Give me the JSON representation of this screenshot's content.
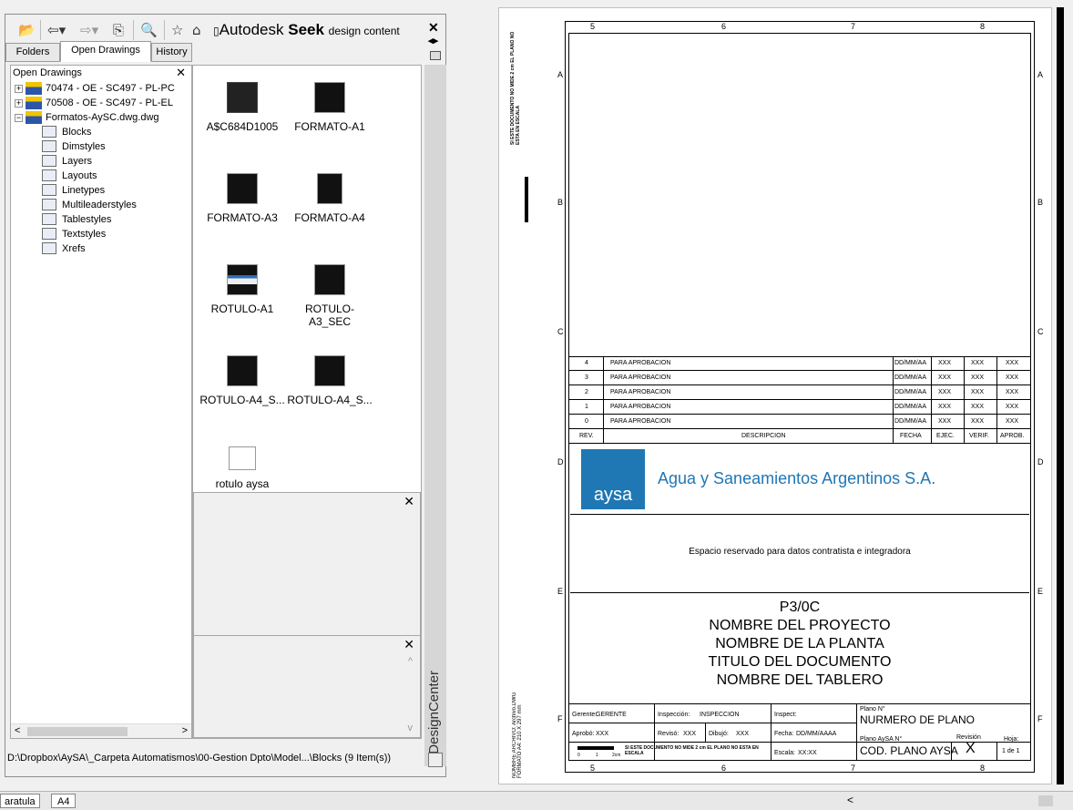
{
  "toolbar": {
    "seek_brand": "Autodesk",
    "seek_word": "Seek",
    "seek_tail": "design content"
  },
  "tabs": [
    {
      "label": "Folders"
    },
    {
      "label": "Open Drawings"
    },
    {
      "label": "History"
    }
  ],
  "tree": {
    "header": "Open Drawings",
    "items": [
      {
        "label": "70474 - OE - SC497 - PL-PC",
        "expander": "+"
      },
      {
        "label": "70508 - OE - SC497 - PL-EL",
        "expander": "+"
      },
      {
        "label": "Formatos-AySC.dwg.dwg",
        "expander": "−"
      },
      {
        "label": "Blocks"
      },
      {
        "label": "Dimstyles"
      },
      {
        "label": "Layers"
      },
      {
        "label": "Layouts"
      },
      {
        "label": "Linetypes"
      },
      {
        "label": "Multileaderstyles"
      },
      {
        "label": "Tablestyles"
      },
      {
        "label": "Textstyles"
      },
      {
        "label": "Xrefs"
      }
    ]
  },
  "blocks": [
    {
      "label": "A$C684D1005"
    },
    {
      "label": "FORMATO-A1"
    },
    {
      "label": "FORMATO-A3"
    },
    {
      "label": "FORMATO-A4"
    },
    {
      "label": "ROTULO-A1"
    },
    {
      "label": "ROTULO-A3_SEC"
    },
    {
      "label": "ROTULO-A4_S..."
    },
    {
      "label": "ROTULO-A4_S..."
    },
    {
      "label": "rotulo aysa"
    }
  ],
  "status_path": "D:\\Dropbox\\AySA\\_Carpeta Automatismos\\00-Gestion Dpto\\Model...\\Blocks (9 Item(s))",
  "palette_caption": "DesignCenter",
  "layout_tabs": [
    {
      "label": "aratula"
    },
    {
      "label": "A4"
    }
  ],
  "sheet": {
    "col_labels": [
      "5",
      "6",
      "7",
      "8"
    ],
    "row_labels": [
      "A",
      "B",
      "C",
      "D",
      "E",
      "F"
    ],
    "left_note_top": "SI ESTE DOCUMENTO NO MIDE 2 cm EL PLANO NO ESTA EN ESCALA",
    "left_note_bottom": "NOMBRE ARCHIVO: Archivo.DWG FORMATO A4: 210 X 297 mm",
    "revisions": [
      {
        "rev": "4",
        "desc": "PARA APROBACION",
        "fecha": "DD/MM/AA",
        "ejec": "XXX",
        "verif": "XXX",
        "aprob": "XXX"
      },
      {
        "rev": "3",
        "desc": "PARA APROBACION",
        "fecha": "DD/MM/AA",
        "ejec": "XXX",
        "verif": "XXX",
        "aprob": "XXX"
      },
      {
        "rev": "2",
        "desc": "PARA APROBACION",
        "fecha": "DD/MM/AA",
        "ejec": "XXX",
        "verif": "XXX",
        "aprob": "XXX"
      },
      {
        "rev": "1",
        "desc": "PARA APROBACION",
        "fecha": "DD/MM/AA",
        "ejec": "XXX",
        "verif": "XXX",
        "aprob": "XXX"
      },
      {
        "rev": "0",
        "desc": "PARA APROBACION",
        "fecha": "DD/MM/AA",
        "ejec": "XXX",
        "verif": "XXX",
        "aprob": "XXX"
      }
    ],
    "rev_header": {
      "rev": "REV.",
      "desc": "DESCRIPCION",
      "fecha": "FECHA",
      "ejec": "EJEC.",
      "verif": "VERIF.",
      "aprob": "APROB."
    },
    "logo_text": "aysa",
    "company": "Agua y Saneamientos Argentinos S.A.",
    "reserved": "Espacio reservado para datos contratista e integradora",
    "titles": [
      "P3/0C",
      "NOMBRE DEL PROYECTO",
      "NOMBRE DE LA PLANTA",
      "TITULO DEL DOCUMENTO",
      "NOMBRE DEL TABLERO"
    ],
    "gerente_label": "Gerente:",
    "gerente": "GERENTE",
    "inspeccion_label": "Inspección:",
    "inspeccion": "INSPECCION",
    "inspect_label": "Inspect:",
    "plano_label": "Plano N°",
    "plano": "NURMERO DE PLANO",
    "aprobo_label": "Aprobó:",
    "aprobo": "XXX",
    "reviso_label": "Revisó:",
    "reviso": "XXX",
    "dibujo_label": "Dibujó:",
    "dibujo": "XXX",
    "fecha_label": "Fecha:",
    "fecha": "DD/MM/AAAA",
    "plano_aysa_label": "Plano AySA N°",
    "plano_aysa": "COD. PLANO AYSA",
    "revision_label": "Revisión",
    "revision": "X",
    "hoja_label": "Hoja:",
    "hoja": "1 de 1",
    "escala_label": "Escala:",
    "escala": "XX:XX",
    "scale_note": "SI ESTE DOCUMENTO NO MIDE 2 cm EL PLANO NO ESTA EN ESCALA",
    "scale_ticks": [
      "0",
      "1",
      "2cm"
    ]
  },
  "colors": {
    "logo_bg": "#1f77b4",
    "company_text": "#1f77b4"
  }
}
